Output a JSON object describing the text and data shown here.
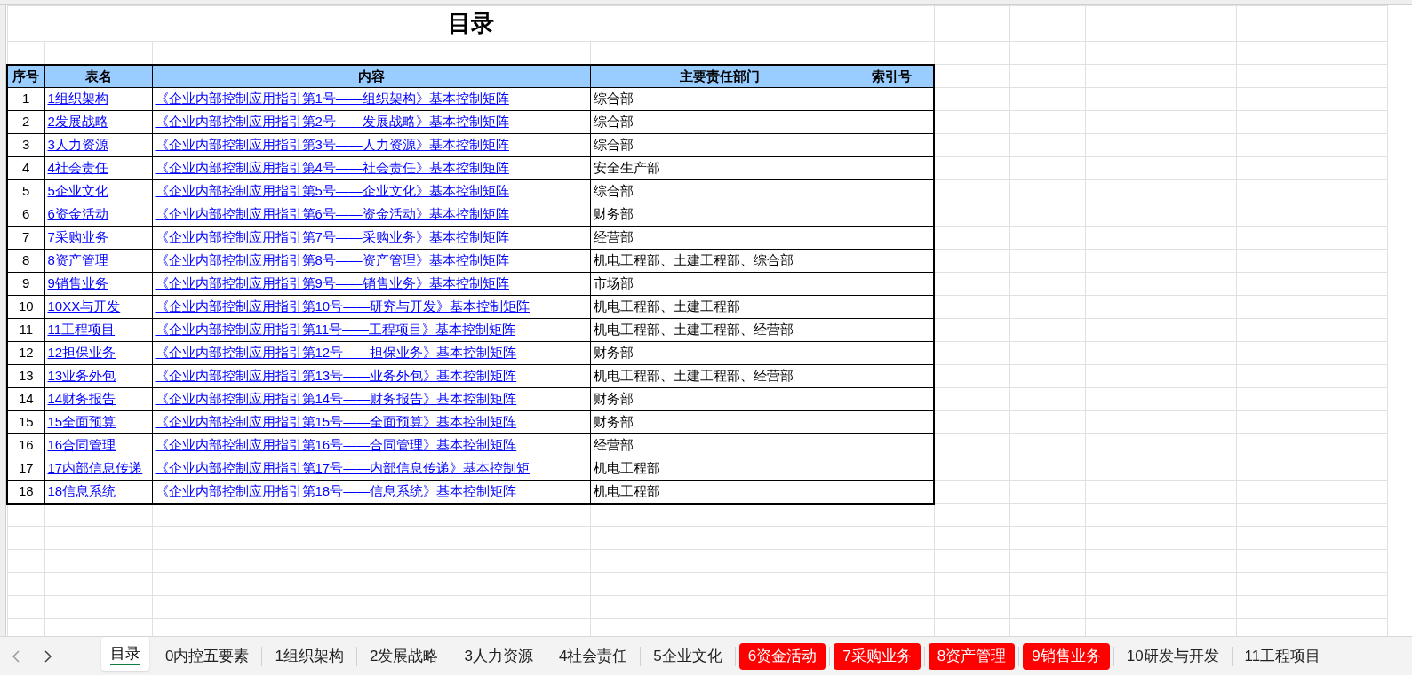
{
  "sheet": {
    "title": "目录",
    "columns": [
      "序号",
      "表名",
      "内容",
      "主要责任部门",
      "索引号"
    ],
    "rows": [
      {
        "no": "1",
        "sheet": "1组织架构",
        "content": "《企业内部控制应用指引第1号——组织架构》基本控制矩阵",
        "dept": "综合部"
      },
      {
        "no": "2",
        "sheet": "2发展战略",
        "content": "《企业内部控制应用指引第2号——发展战略》基本控制矩阵",
        "dept": "综合部"
      },
      {
        "no": "3",
        "sheet": "3人力资源",
        "content": "《企业内部控制应用指引第3号——人力资源》基本控制矩阵",
        "dept": "综合部"
      },
      {
        "no": "4",
        "sheet": "4社会责任",
        "content": "《企业内部控制应用指引第4号——社会责任》基本控制矩阵",
        "dept": "安全生产部"
      },
      {
        "no": "5",
        "sheet": "5企业文化",
        "content": "《企业内部控制应用指引第5号——企业文化》基本控制矩阵",
        "dept": "综合部"
      },
      {
        "no": "6",
        "sheet": "6资金活动",
        "content": "《企业内部控制应用指引第6号——资金活动》基本控制矩阵",
        "dept": "财务部"
      },
      {
        "no": "7",
        "sheet": "7采购业务",
        "content": "《企业内部控制应用指引第7号——采购业务》基本控制矩阵",
        "dept": "经营部"
      },
      {
        "no": "8",
        "sheet": "8资产管理",
        "content": "《企业内部控制应用指引第8号——资产管理》基本控制矩阵",
        "dept": "机电工程部、土建工程部、综合部"
      },
      {
        "no": "9",
        "sheet": "9销售业务",
        "content": "《企业内部控制应用指引第9号——销售业务》基本控制矩阵",
        "dept": "市场部"
      },
      {
        "no": "10",
        "sheet": "10XX与开发",
        "content": "《企业内部控制应用指引第10号——研究与开发》基本控制矩阵",
        "dept": "机电工程部、土建工程部"
      },
      {
        "no": "11",
        "sheet": "11工程项目",
        "content": "《企业内部控制应用指引第11号——工程项目》基本控制矩阵",
        "dept": "机电工程部、土建工程部、经营部"
      },
      {
        "no": "12",
        "sheet": "12担保业务",
        "content": "《企业内部控制应用指引第12号——担保业务》基本控制矩阵",
        "dept": "财务部"
      },
      {
        "no": "13",
        "sheet": "13业务外包",
        "content": "《企业内部控制应用指引第13号——业务外包》基本控制矩阵",
        "dept": "机电工程部、土建工程部、经营部"
      },
      {
        "no": "14",
        "sheet": "14财务报告",
        "content": "《企业内部控制应用指引第14号——财务报告》基本控制矩阵",
        "dept": "财务部"
      },
      {
        "no": "15",
        "sheet": "15全面预算",
        "content": "《企业内部控制应用指引第15号——全面预算》基本控制矩阵",
        "dept": "财务部"
      },
      {
        "no": "16",
        "sheet": "16合同管理",
        "content": "《企业内部控制应用指引第16号——合同管理》基本控制矩阵",
        "dept": "经营部"
      },
      {
        "no": "17",
        "sheet": "17内部信息传递",
        "content": "《企业内部控制应用指引第17号——内部信息传递》基本控制矩",
        "dept": "机电工程部"
      },
      {
        "no": "18",
        "sheet": "18信息系统",
        "content": "《企业内部控制应用指引第18号——信息系统》基本控制矩阵",
        "dept": "机电工程部"
      }
    ]
  },
  "sheet_tabs": [
    {
      "label": "目录",
      "selected": true
    },
    {
      "label": "0内控五要素",
      "selected": false
    },
    {
      "label": "1组织架构",
      "selected": false
    },
    {
      "label": "2发展战略",
      "selected": false
    },
    {
      "label": "3人力资源",
      "selected": false
    },
    {
      "label": "4社会责任",
      "selected": false
    },
    {
      "label": "5企业文化",
      "selected": false
    },
    {
      "label": "6资金活动",
      "selected": false,
      "color": "#ff0000"
    },
    {
      "label": "7采购业务",
      "selected": false,
      "color": "#ff0000"
    },
    {
      "label": "8资产管理",
      "selected": false,
      "color": "#ff0000"
    },
    {
      "label": "9销售业务",
      "selected": false,
      "color": "#ff0000"
    },
    {
      "label": "10研发与开发",
      "selected": false
    },
    {
      "label": "11工程项目",
      "selected": false
    }
  ]
}
